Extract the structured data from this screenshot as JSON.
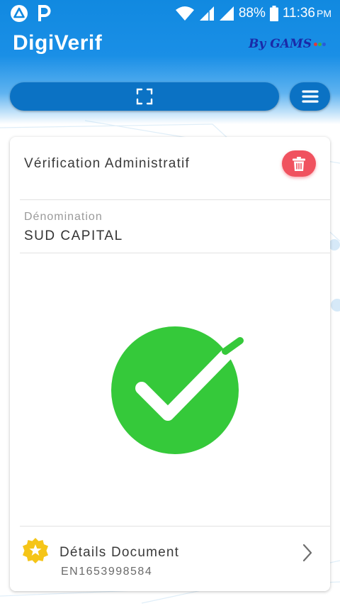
{
  "status_bar": {
    "battery": "88%",
    "time": "11:36",
    "ampm": "PM",
    "icons": [
      "app-triangle-icon",
      "parking-icon",
      "wifi-icon",
      "signal-icon",
      "signal-icon",
      "battery-icon"
    ]
  },
  "header": {
    "title": "DigiVerif",
    "brand": "By GAMS",
    "colors": {
      "header_blue": "#1189e0",
      "button_blue": "#0b72c4",
      "brand_text": "#1a2aa8"
    }
  },
  "toolbar": {
    "scan_icon": "scan-frame-icon",
    "menu_icon": "hamburger-menu-icon"
  },
  "card": {
    "title": "Vérification Administratif",
    "delete_icon": "trash-icon",
    "field": {
      "label": "Dénomination",
      "value": "SUD CAPITAL"
    },
    "status_icon": "check-circle-icon",
    "status_color": "#35c93a",
    "details": {
      "label": "Détails Document",
      "number": "EN1653998584",
      "icon": "star-badge-icon",
      "chevron": "chevron-right-icon"
    }
  }
}
